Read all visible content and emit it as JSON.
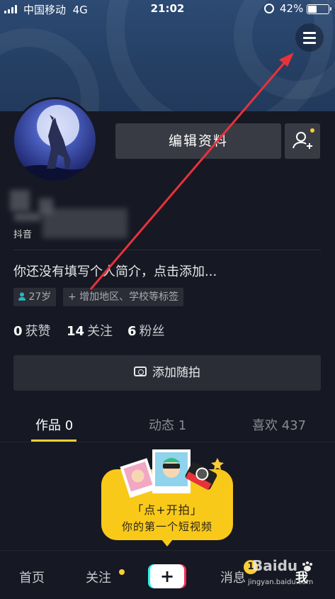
{
  "status_bar": {
    "carrier": "中国移动",
    "network": "4G",
    "time": "21:02",
    "battery": "42%"
  },
  "profile": {
    "edit_profile": "编辑资料",
    "douyin_id_label": "抖音",
    "bio": "你还没有填写个人简介，点击添加...",
    "age_tag": "27岁",
    "add_tag": "+ 增加地区、学校等标签"
  },
  "stats": {
    "likes_count": "0",
    "likes_label": "获赞",
    "following_count": "14",
    "following_label": "关注",
    "followers_count": "6",
    "followers_label": "粉丝"
  },
  "add_moment": "添加随拍",
  "tabs": {
    "works": "作品 0",
    "dynamics": "动态 1",
    "likes": "喜欢 437"
  },
  "shoot_prompt": {
    "line1": "「点+开拍」",
    "line2": "你的第一个短视频"
  },
  "bottom_nav": {
    "home": "首页",
    "follow": "关注",
    "plus": "+",
    "messages": "消息",
    "messages_badge": "1",
    "me": "我"
  },
  "watermark": {
    "logo": "Baidu",
    "url": "jingyan.baidu.com"
  },
  "colors": {
    "background": "#161823",
    "accent": "#facd35",
    "annotation_arrow": "#e8323a"
  }
}
